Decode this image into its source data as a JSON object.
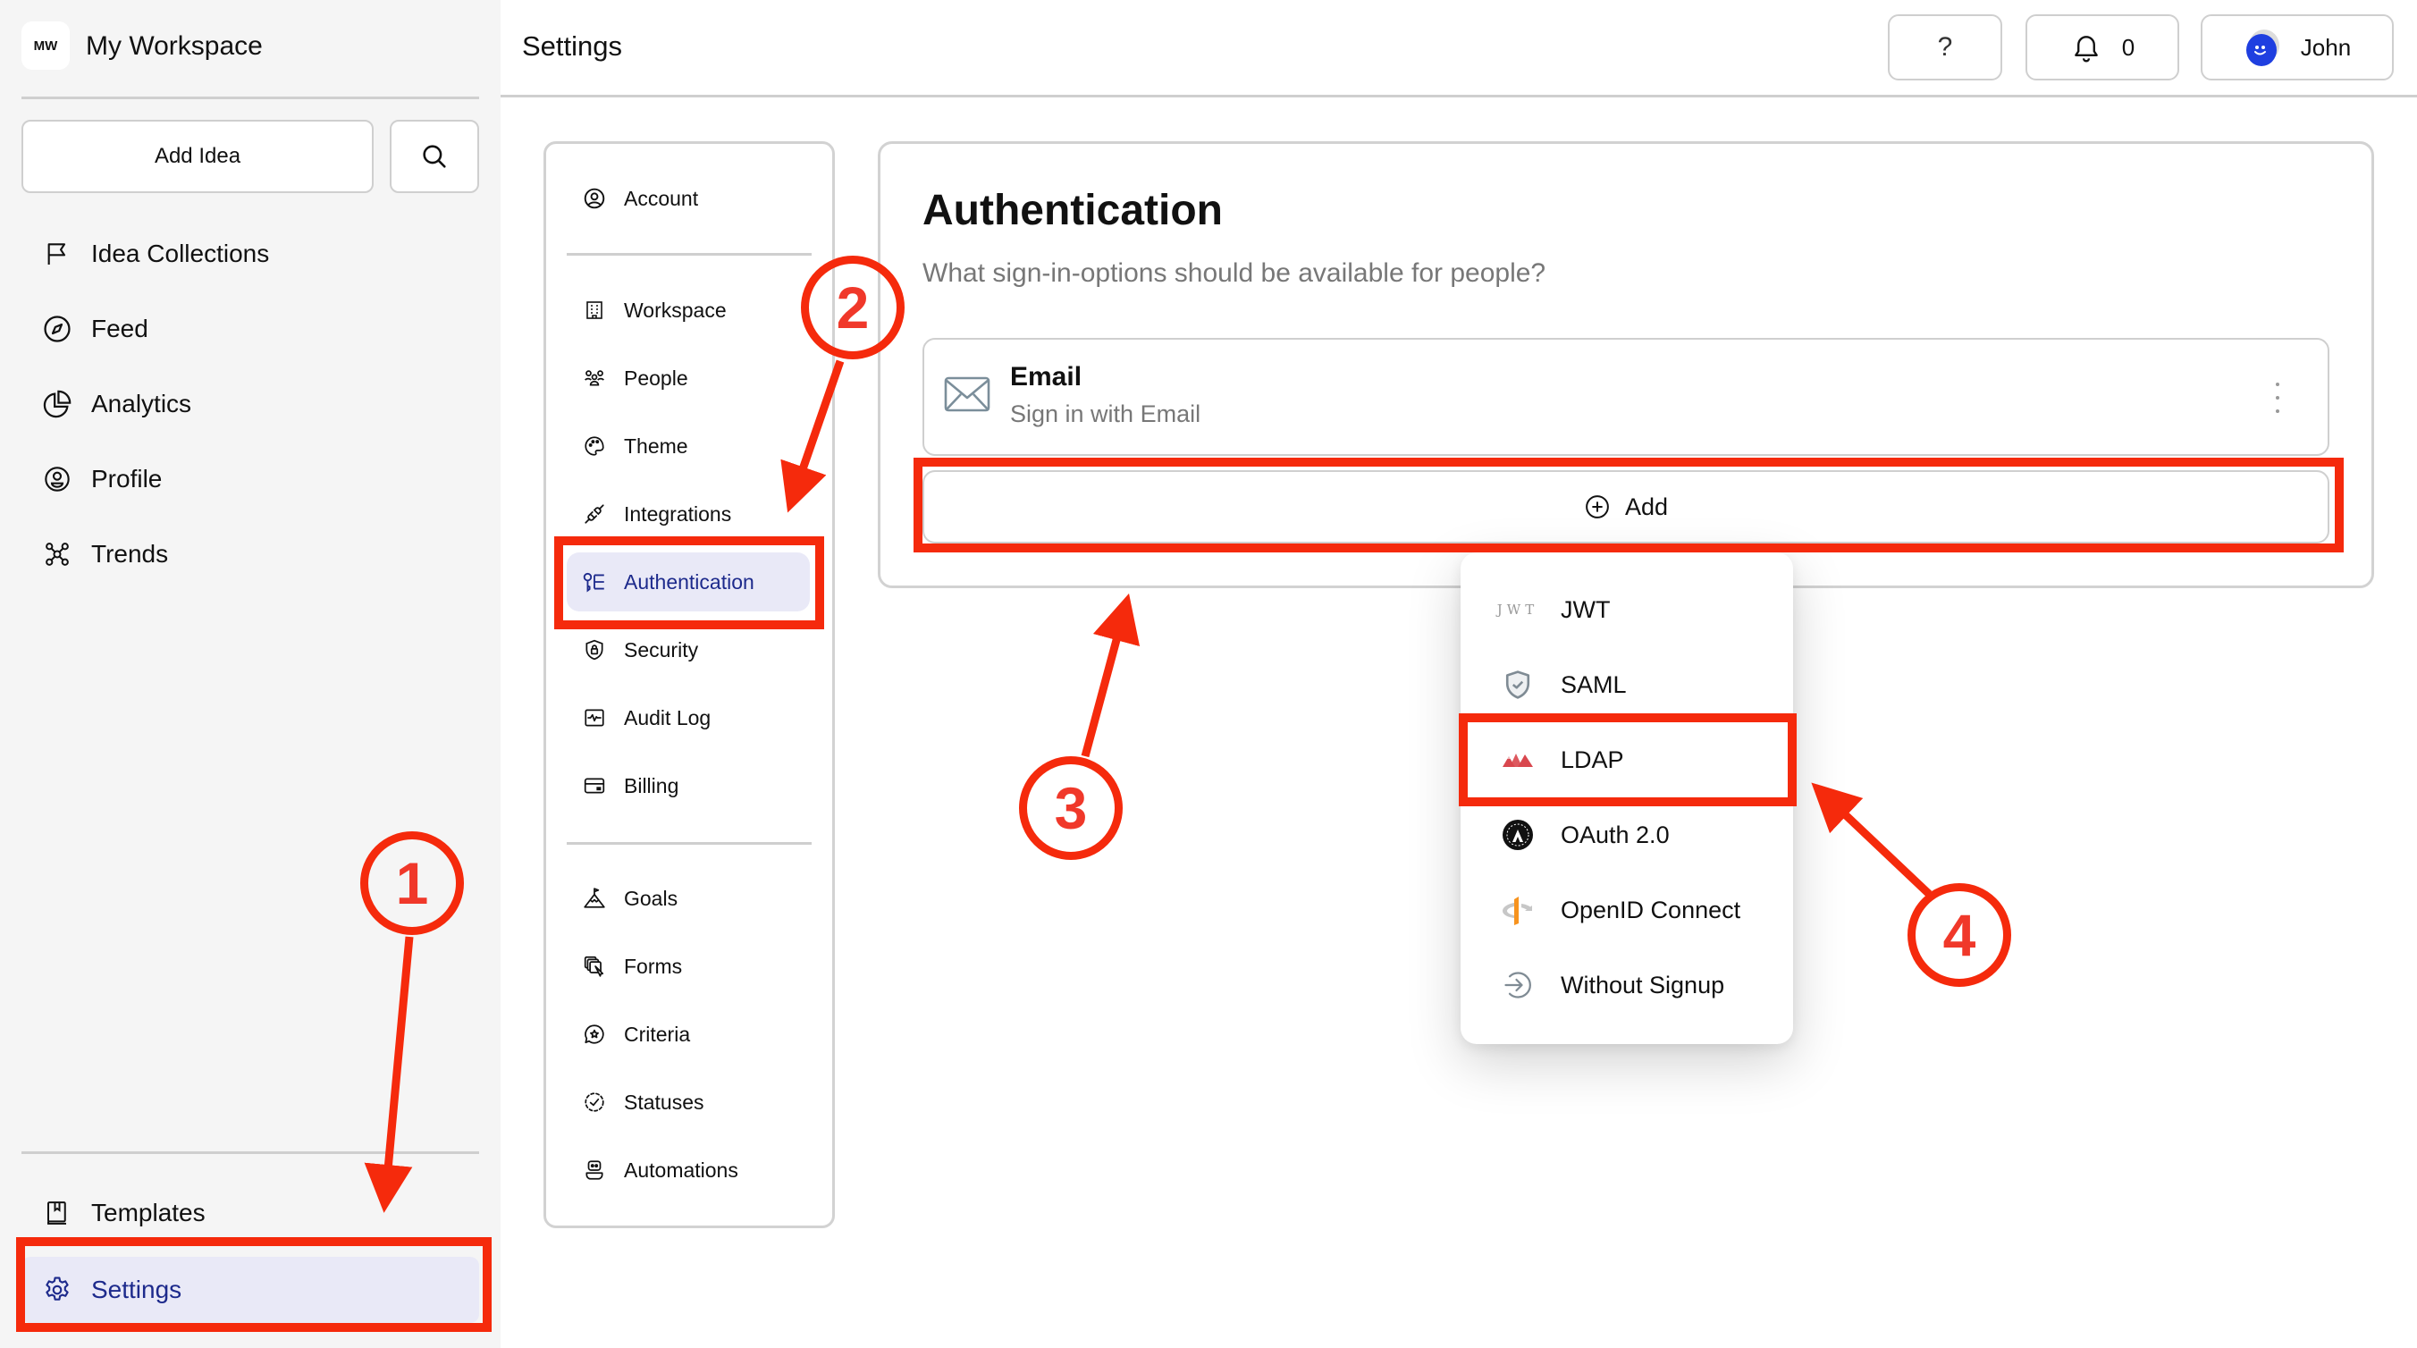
{
  "workspace": {
    "logo_initials": "MW",
    "name": "My Workspace"
  },
  "sidebar": {
    "add_idea_label": "Add Idea",
    "search_icon": "search-icon",
    "items": [
      {
        "label": "Idea Collections",
        "icon": "flag-icon"
      },
      {
        "label": "Feed",
        "icon": "compass-icon"
      },
      {
        "label": "Analytics",
        "icon": "pie-chart-icon"
      },
      {
        "label": "Profile",
        "icon": "user-circle-icon"
      },
      {
        "label": "Trends",
        "icon": "network-icon"
      }
    ],
    "bottom_items": [
      {
        "label": "Templates",
        "icon": "book-icon"
      },
      {
        "label": "Settings",
        "icon": "gear-icon",
        "active": true
      }
    ]
  },
  "topbar": {
    "title": "Settings",
    "help_label": "?",
    "notifications_count": "0",
    "user_name": "John"
  },
  "settings_nav": {
    "groups": [
      [
        {
          "label": "Account",
          "icon": "user-circle-icon"
        }
      ],
      [
        {
          "label": "Workspace",
          "icon": "building-icon"
        },
        {
          "label": "People",
          "icon": "people-icon"
        },
        {
          "label": "Theme",
          "icon": "palette-icon"
        },
        {
          "label": "Integrations",
          "icon": "plug-icon"
        },
        {
          "label": "Authentication",
          "icon": "key-list-icon",
          "active": true
        },
        {
          "label": "Security",
          "icon": "shield-lock-icon"
        },
        {
          "label": "Audit Log",
          "icon": "activity-icon"
        },
        {
          "label": "Billing",
          "icon": "credit-card-icon"
        }
      ],
      [
        {
          "label": "Goals",
          "icon": "mountain-flag-icon"
        },
        {
          "label": "Forms",
          "icon": "forms-icon"
        },
        {
          "label": "Criteria",
          "icon": "star-bubble-icon"
        },
        {
          "label": "Statuses",
          "icon": "dashed-check-icon"
        },
        {
          "label": "Automations",
          "icon": "robot-icon"
        }
      ]
    ]
  },
  "auth": {
    "title": "Authentication",
    "subtitle": "What sign-in-options should be available for people?",
    "methods": [
      {
        "title": "Email",
        "description": "Sign in with Email",
        "icon": "envelope-icon"
      }
    ],
    "add_label": "Add"
  },
  "dropdown": {
    "options": [
      {
        "label": "JWT",
        "icon": "jwt-icon",
        "icon_text": "JWT"
      },
      {
        "label": "SAML",
        "icon": "shield-check-icon"
      },
      {
        "label": "LDAP",
        "icon": "ldap-mountains-icon",
        "highlighted": true
      },
      {
        "label": "OAuth 2.0",
        "icon": "oauth-icon"
      },
      {
        "label": "OpenID Connect",
        "icon": "openid-icon"
      },
      {
        "label": "Without Signup",
        "icon": "sign-in-arrow-icon"
      }
    ]
  },
  "annotations": {
    "color": "#f52a0c",
    "steps": [
      "1",
      "2",
      "3",
      "4"
    ]
  },
  "colors": {
    "active_bg": "#e9e9f7",
    "active_text": "#1d2a8c",
    "avatar": "#1f3fe0",
    "ldap": "#d9474e",
    "openid_orange": "#f7931e"
  }
}
